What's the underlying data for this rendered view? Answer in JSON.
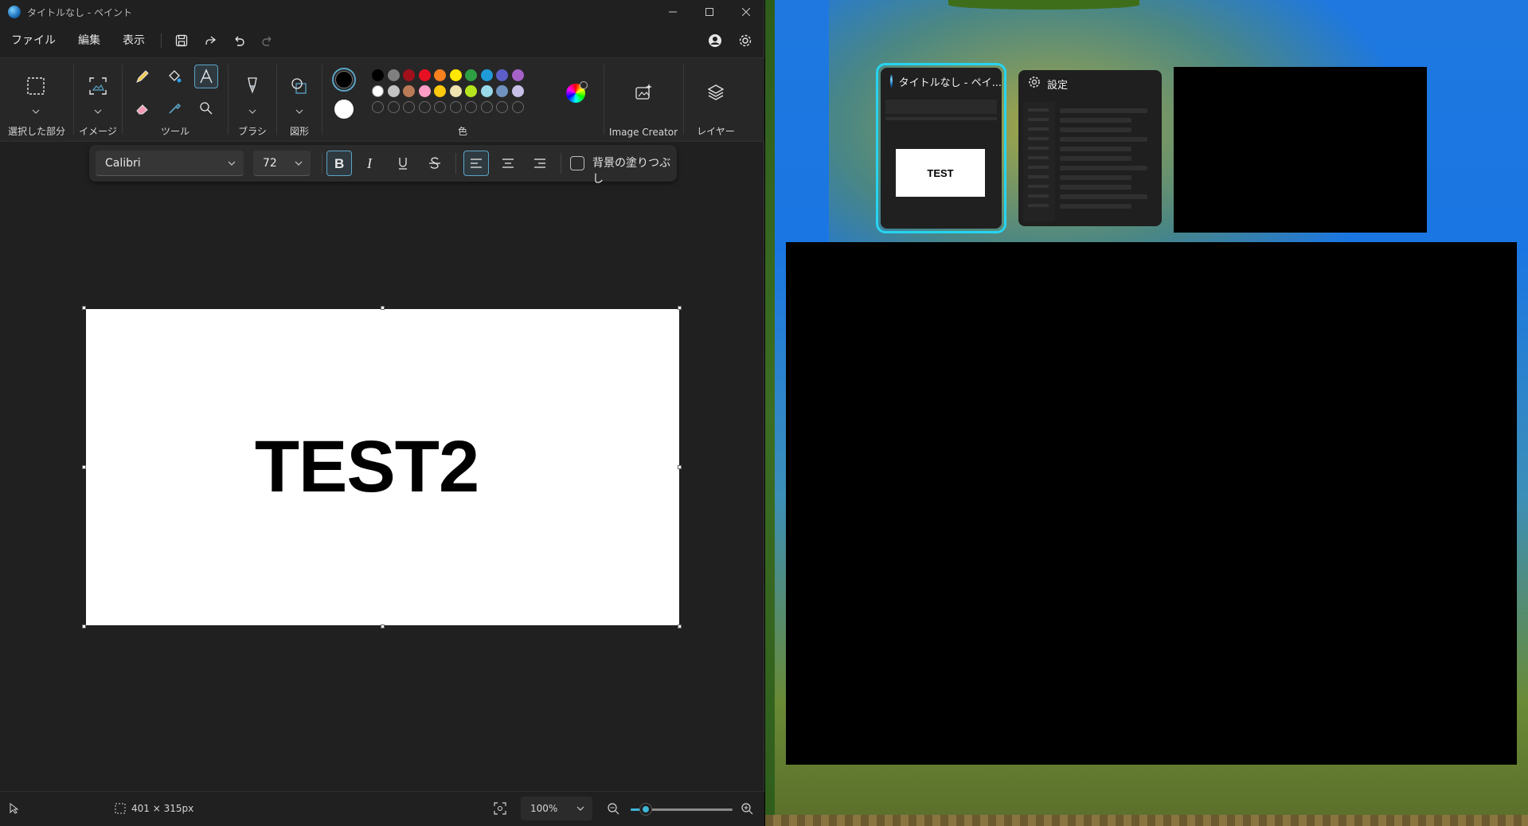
{
  "paint": {
    "title": "タイトルなし - ペイント",
    "menu": [
      "ファイル",
      "編集",
      "表示"
    ],
    "groups": {
      "selection": "選択した部分",
      "image": "イメージ",
      "tools": "ツール",
      "brush": "ブラシ",
      "shapes": "図形",
      "colors": "色",
      "image_creator": "Image Creator",
      "layers": "レイヤー"
    },
    "palette": {
      "row1": [
        "#000000",
        "#7f7f7f",
        "#a0111c",
        "#e81123",
        "#f7801f",
        "#ffe800",
        "#2ea043",
        "#1e9bd8",
        "#5b5fc7",
        "#a561c7"
      ],
      "row2": [
        "#ffffff",
        "#c3c3c3",
        "#b97a57",
        "#ff9cc5",
        "#ffc90e",
        "#efe4b0",
        "#b5e61d",
        "#99d9ea",
        "#7092be",
        "#c8bfe7"
      ],
      "primary": "#000000",
      "secondary": "#ffffff"
    },
    "format": {
      "font": "Calibri",
      "size": "72",
      "bg_fill_label": "背景の塗りつぶし"
    },
    "canvas_text": "TEST2",
    "status": {
      "selection_size": "401 × 315px",
      "zoom": "100%",
      "zoom_level": 0.15
    }
  },
  "switcher": {
    "windows": [
      {
        "title": "タイトルなし - ペイ...",
        "preview_text": "TEST"
      },
      {
        "title": "設定"
      }
    ]
  },
  "colors": {
    "accent": "#26d4f0",
    "selected_tool": "#5aa5c8"
  }
}
